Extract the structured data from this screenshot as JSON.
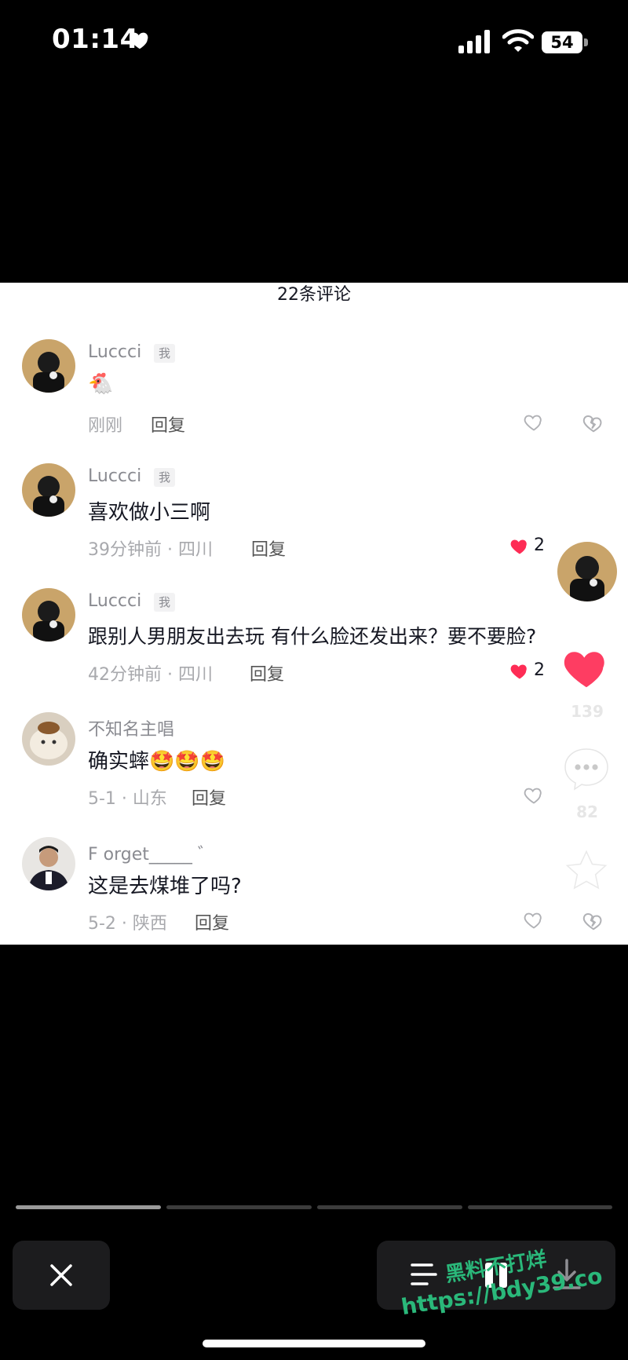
{
  "status_bar": {
    "time": "01:14",
    "battery": "54"
  },
  "sheet": {
    "title": "22条评论"
  },
  "comments": [
    {
      "username": "Luccci",
      "tag": "我",
      "text": "🐔",
      "time_location": "刚刚",
      "reply": "回复",
      "likes": ""
    },
    {
      "username": "Luccci",
      "tag": "我",
      "text": "喜欢做小三啊",
      "time_location": "39分钟前 · 四川",
      "reply": "回复",
      "likes": "2"
    },
    {
      "username": "Luccci",
      "tag": "我",
      "text": "跟别人男朋友出去玩 有什么脸还发出来？要不要脸?",
      "time_location": "42分钟前 · 四川",
      "reply": "回复",
      "likes": "2"
    },
    {
      "username": "不知名主唱",
      "tag": "",
      "text": "确实蟀🤩🤩🤩",
      "time_location": "5-1 · 山东",
      "reply": "回复",
      "likes": ""
    },
    {
      "username": "F orget_____ ゛",
      "tag": "",
      "text": "这是去煤堆了吗?",
      "time_location": "5-2 · 陕西",
      "reply": "回复",
      "likes": ""
    }
  ],
  "side_actions": {
    "like_count": "139",
    "comment_count": "82"
  },
  "progress": {
    "segments": 4,
    "active_index": 0
  },
  "watermark": {
    "line1": "黑料不打烊",
    "line2": "https://bdy39.co"
  },
  "icons": {
    "status_heart": "heart-icon",
    "signal": "signal-icon",
    "wifi": "wifi-icon",
    "close": "close-icon",
    "menu": "menu-icon",
    "pause": "pause-icon",
    "download": "download-icon"
  },
  "colors": {
    "like_red": "#fe2c55",
    "watermark_green": "#2ab87a"
  }
}
